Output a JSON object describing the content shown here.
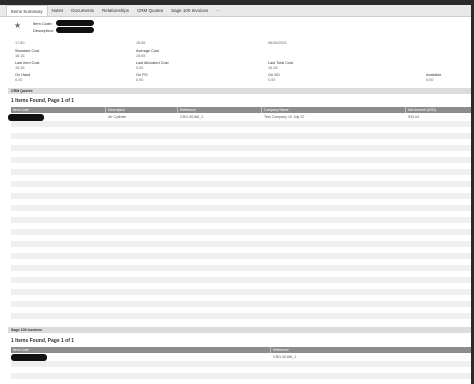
{
  "tabs": [
    "Items Summary",
    "Notes",
    "Documents",
    "Relationships",
    "CRM Quotes",
    "Sage 100 Invoices",
    "⋯"
  ],
  "header": {
    "item_code_label": "Item Code:",
    "description_label": "Description:"
  },
  "summary_fields": {
    "row0": {
      "values": [
        "17.60",
        "15.65",
        "06/28/2021"
      ]
    },
    "row1": [
      {
        "label": "Standard Cost",
        "value": "16.15"
      },
      {
        "label": "Average Cost",
        "value": "15.65"
      }
    ],
    "row2": [
      {
        "label": "Last Item Cost",
        "value": "15.28"
      },
      {
        "label": "Last Allocated Cost",
        "value": "0.00"
      },
      {
        "label": "Last Total Cost",
        "value": "15.28"
      }
    ],
    "row3": [
      {
        "label": "On Hand",
        "value": "0.00"
      },
      {
        "label": "On PO",
        "value": "0.00"
      },
      {
        "label": "On SO",
        "value": "0.00"
      },
      {
        "label": "Available",
        "value": "0.00"
      }
    ]
  },
  "crm_quotes": {
    "section_title": "CRM Quotes",
    "found_text": "1 Items Found, Page 1 of 1",
    "columns": [
      "Item Code",
      "Description",
      "Reference",
      "Company Name",
      "Net Amount (USD)"
    ],
    "rows": [
      {
        "item_code": "",
        "description": "Air Cylinder",
        "reference": "CRO-40166_1",
        "company": "Test Company 19 July 22",
        "amount": "933.04"
      }
    ]
  },
  "sage_invoices": {
    "section_title": "Sage 100 Invoices",
    "found_text": "1 Items Found, Page 1 of 1",
    "columns": [
      "Item Code",
      "Reference"
    ],
    "rows": [
      {
        "item_code": "",
        "reference": "CRO-40166_1"
      }
    ]
  },
  "colors": {
    "header_bar": "#8c8c8c",
    "tab_bar": "#e9e9e9",
    "redaction": "#111111"
  }
}
